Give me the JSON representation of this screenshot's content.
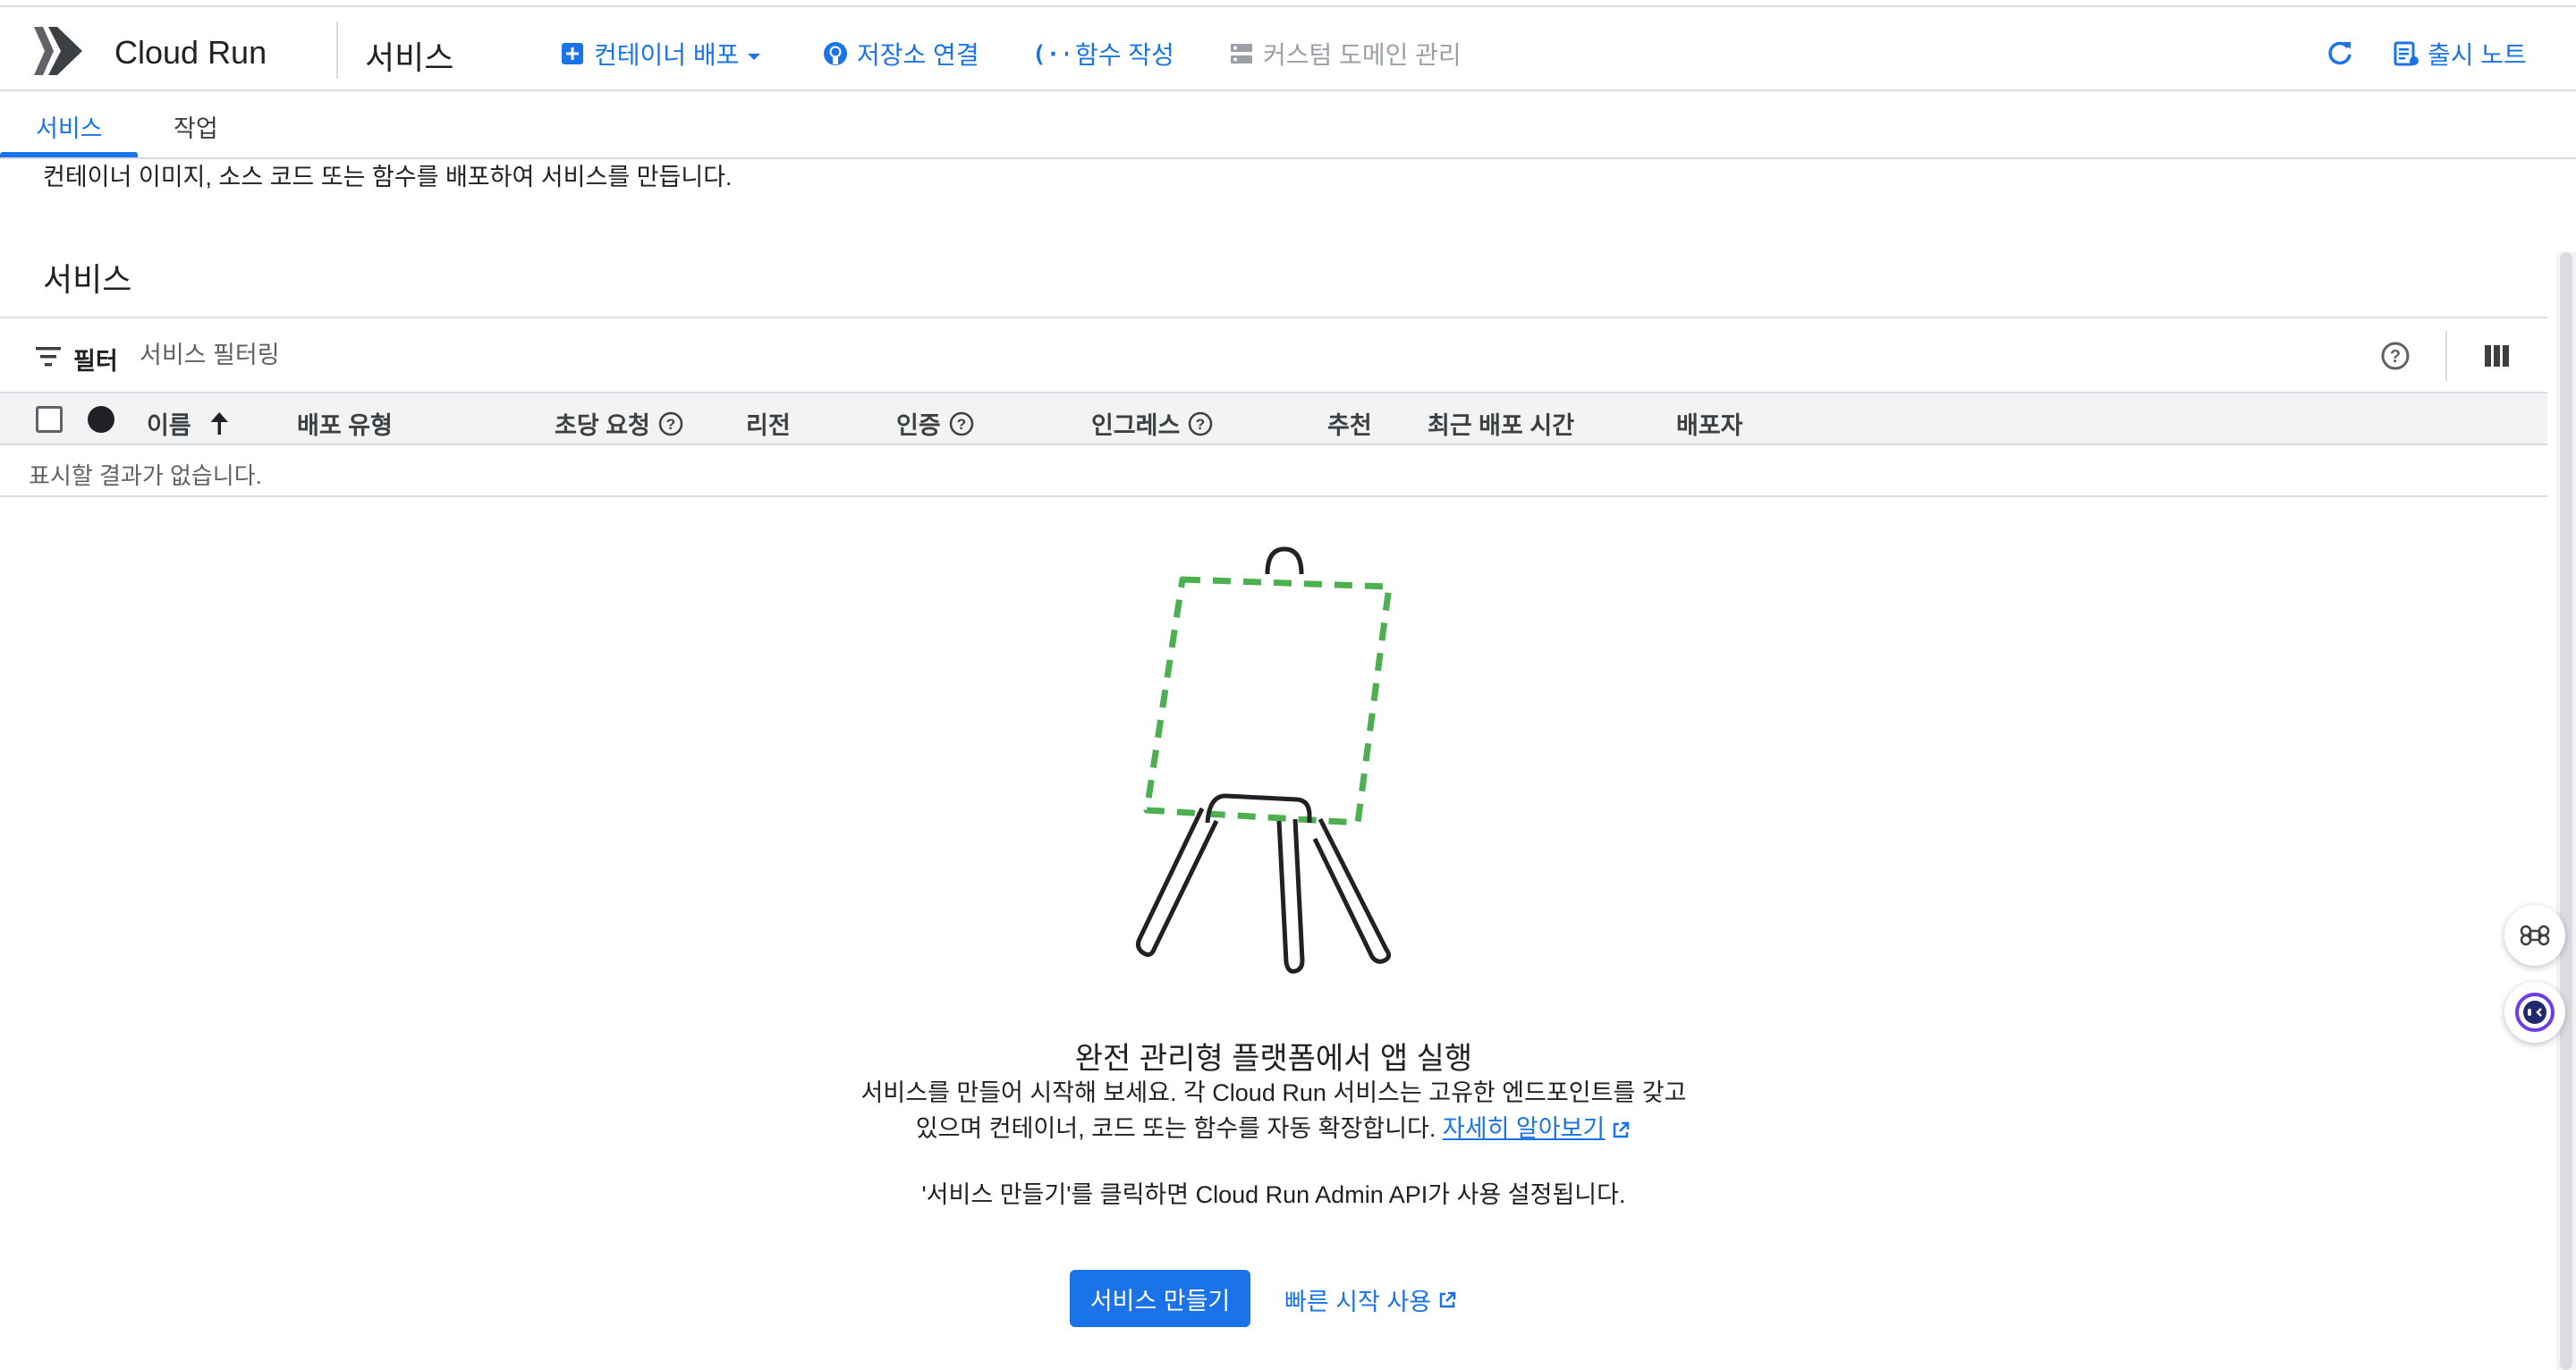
{
  "header": {
    "product_name": "Cloud Run",
    "page_title": "서비스",
    "actions": {
      "deploy_container": "컨테이너 배포",
      "connect_repo": "저장소 연결",
      "write_function": "함수 작성",
      "manage_domains": "커스텀 도메인 관리",
      "release_notes": "출시 노트"
    },
    "icons": {
      "logo": "cloud-run-logo",
      "deploy": "add-box-icon",
      "repo": "github-icon",
      "function": "function-braces-icon",
      "domain": "dns-icon",
      "refresh": "refresh-icon",
      "notes": "release-notes-icon"
    },
    "accent_color": "#1a73e8"
  },
  "tabs": [
    {
      "label": "서비스",
      "active": true
    },
    {
      "label": "작업",
      "active": false
    }
  ],
  "intro_text": "컨테이너 이미지, 소스 코드 또는 함수를 배포하여 서비스를 만듭니다.",
  "section_title": "서비스",
  "filter": {
    "label": "필터",
    "placeholder": "서비스 필터링"
  },
  "table": {
    "columns": {
      "name": "이름",
      "deploy_type": "배포 유형",
      "requests_per_sec": "초당 요청",
      "region": "리전",
      "auth": "인증",
      "ingress": "인그레스",
      "recommendation": "추천",
      "last_deployed": "최근 배포 시간",
      "deployer": "배포자"
    },
    "empty_message": "표시할 결과가 없습니다."
  },
  "empty_state": {
    "title": "완전 관리형 플랫폼에서 앱 실행",
    "description_line1": "서비스를 만들어 시작해 보세요. 각 Cloud Run 서비스는 고유한 엔드포인트를 갖고",
    "description_line2": "있으며 컨테이너, 코드 또는 함수를 자동 확장합니다.",
    "learn_more": "자세히 알아보기",
    "api_note": "'서비스 만들기'를 클릭하면 Cloud Run Admin API가 사용 설정됩니다.",
    "create_button": "서비스 만들기",
    "quickstart_link": "빠른 시작 사용",
    "illustration": "easel-illustration",
    "canvas_color": "#4caf50"
  }
}
